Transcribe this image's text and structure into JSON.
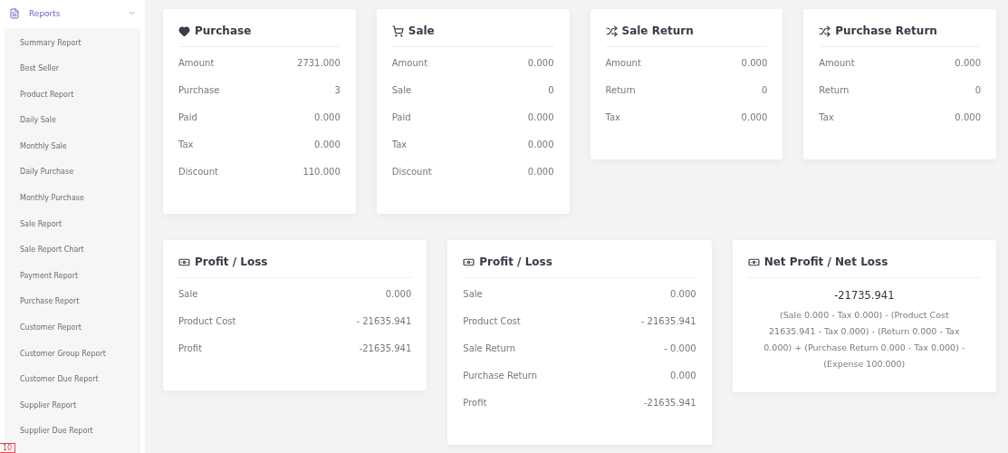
{
  "sidebar": {
    "menu": {
      "label": "Reports",
      "expanded": true
    },
    "items": [
      {
        "label": "Summary Report"
      },
      {
        "label": "Best Seller"
      },
      {
        "label": "Product Report"
      },
      {
        "label": "Daily Sale"
      },
      {
        "label": "Monthly Sale"
      },
      {
        "label": "Daily Purchase"
      },
      {
        "label": "Monthly Purchase"
      },
      {
        "label": "Sale Report"
      },
      {
        "label": "Sale Report Chart"
      },
      {
        "label": "Payment Report"
      },
      {
        "label": "Purchase Report"
      },
      {
        "label": "Customer Report"
      },
      {
        "label": "Customer Group Report"
      },
      {
        "label": "Customer Due Report"
      },
      {
        "label": "Supplier Report"
      },
      {
        "label": "Supplier Due Report"
      }
    ]
  },
  "corner_badge": "10",
  "card_rows": [
    [
      {
        "kind": "stats",
        "title": "Purchase",
        "rows": [
          [
            "Amount",
            "2731.000"
          ],
          [
            "Purchase",
            "3"
          ],
          [
            "Paid",
            "0.000"
          ],
          [
            "Tax",
            "0.000"
          ],
          [
            "Discount",
            "110.000"
          ]
        ]
      },
      {
        "kind": "stats",
        "title": "Sale",
        "rows": [
          [
            "Amount",
            "0.000"
          ],
          [
            "Sale",
            "0"
          ],
          [
            "Paid",
            "0.000"
          ],
          [
            "Tax",
            "0.000"
          ],
          [
            "Discount",
            "0.000"
          ]
        ]
      },
      {
        "kind": "stats",
        "title": "Sale Return",
        "rows": [
          [
            "Amount",
            "0.000"
          ],
          [
            "Return",
            "0"
          ],
          [
            "Tax",
            "0.000"
          ]
        ]
      },
      {
        "kind": "stats",
        "title": "Purchase Return",
        "rows": [
          [
            "Amount",
            "0.000"
          ],
          [
            "Return",
            "0"
          ],
          [
            "Tax",
            "0.000"
          ]
        ]
      }
    ],
    [
      {
        "kind": "stats",
        "title": "Profit / Loss",
        "rows": [
          [
            "Sale",
            "0.000"
          ],
          [
            "Product Cost",
            "- 21635.941"
          ],
          [
            "Profit",
            "-21635.941"
          ]
        ]
      },
      {
        "kind": "stats",
        "title": "Profit / Loss",
        "rows": [
          [
            "Sale",
            "0.000"
          ],
          [
            "Product Cost",
            "- 21635.941"
          ],
          [
            "Sale Return",
            "- 0.000"
          ],
          [
            "Purchase Return",
            "0.000"
          ],
          [
            "Profit",
            "-21635.941"
          ]
        ]
      },
      {
        "kind": "summary",
        "title": "Net Profit / Net Loss",
        "value": "-21735.941",
        "formula": "(Sale 0.000 - Tax 0.000) - (Product Cost 21635.941 - Tax 0.000) - (Return 0.000 - Tax 0.000) + (Purchase Return 0.000 - Tax 0.000) - (Expense 100.000)"
      }
    ]
  ]
}
